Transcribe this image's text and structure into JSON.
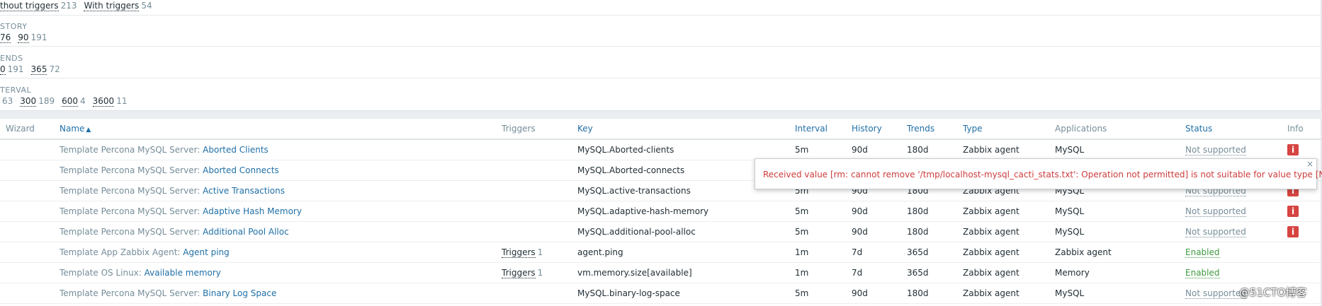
{
  "filters": {
    "triggers_row": [
      {
        "label": "thout triggers",
        "count": "213"
      },
      {
        "label": "With triggers",
        "count": "54"
      }
    ],
    "history": {
      "title": "STORY",
      "items": [
        {
          "label": "76",
          "count": ""
        },
        {
          "label": "90",
          "count": "191"
        }
      ]
    },
    "trends": {
      "title": "ENDS",
      "items": [
        {
          "label": "0",
          "count": "191"
        },
        {
          "label": "365",
          "count": "72"
        }
      ]
    },
    "interval": {
      "title": "TERVAL",
      "items": [
        {
          "label": "",
          "count": "63"
        },
        {
          "label": "300",
          "count": "189"
        },
        {
          "label": "600",
          "count": "4"
        },
        {
          "label": "3600",
          "count": "11"
        }
      ]
    }
  },
  "table": {
    "headers": {
      "wizard": "Wizard",
      "name": "Name",
      "triggers": "Triggers",
      "key": "Key",
      "interval": "Interval",
      "history": "History",
      "trends": "Trends",
      "type": "Type",
      "applications": "Applications",
      "status": "Status",
      "info": "Info"
    },
    "sort_indicator": "▲",
    "rows": [
      {
        "template": "Template Percona MySQL Server",
        "name": "Aborted Clients",
        "triggers": "",
        "trig_count": "",
        "key": "MySQL.Aborted-clients",
        "interval": "5m",
        "history": "90d",
        "trends": "180d",
        "type": "Zabbix agent",
        "app": "MySQL",
        "status": "Not supported",
        "info": "i"
      },
      {
        "template": "Template Percona MySQL Server",
        "name": "Aborted Connects",
        "triggers": "",
        "trig_count": "",
        "key": "MySQL.Aborted-connects",
        "interval": "",
        "history": "",
        "trends": "",
        "type": "",
        "app": "",
        "status": "",
        "info": ""
      },
      {
        "template": "Template Percona MySQL Server",
        "name": "Active Transactions",
        "triggers": "",
        "trig_count": "",
        "key": "MySQL.active-transactions",
        "interval": "5m",
        "history": "90d",
        "trends": "180d",
        "type": "Zabbix agent",
        "app": "MySQL",
        "status": "Not supported",
        "info": "i"
      },
      {
        "template": "Template Percona MySQL Server",
        "name": "Adaptive Hash Memory",
        "triggers": "",
        "trig_count": "",
        "key": "MySQL.adaptive-hash-memory",
        "interval": "5m",
        "history": "90d",
        "trends": "180d",
        "type": "Zabbix agent",
        "app": "MySQL",
        "status": "Not supported",
        "info": "i"
      },
      {
        "template": "Template Percona MySQL Server",
        "name": "Additional Pool Alloc",
        "triggers": "",
        "trig_count": "",
        "key": "MySQL.additional-pool-alloc",
        "interval": "5m",
        "history": "90d",
        "trends": "180d",
        "type": "Zabbix agent",
        "app": "MySQL",
        "status": "Not supported",
        "info": "i"
      },
      {
        "template": "Template App Zabbix Agent",
        "name": "Agent ping",
        "triggers": "Triggers",
        "trig_count": "1",
        "key": "agent.ping",
        "interval": "1m",
        "history": "7d",
        "trends": "365d",
        "type": "Zabbix agent",
        "app": "Zabbix agent",
        "status": "Enabled",
        "info": ""
      },
      {
        "template": "Template OS Linux",
        "name": "Available memory",
        "triggers": "Triggers",
        "trig_count": "1",
        "key": "vm.memory.size[available]",
        "interval": "1m",
        "history": "7d",
        "trends": "365d",
        "type": "Zabbix agent",
        "app": "Memory",
        "status": "Enabled",
        "info": ""
      },
      {
        "template": "Template Percona MySQL Server",
        "name": "Binary Log Space",
        "triggers": "",
        "trig_count": "",
        "key": "MySQL.binary-log-space",
        "interval": "5m",
        "history": "90d",
        "trends": "180d",
        "type": "Zabbix agent",
        "app": "MySQL",
        "status": "Not supported",
        "info": ""
      }
    ]
  },
  "hint": {
    "message": "Received value [rm: cannot remove '/tmp/localhost-mysql_cacti_stats.txt': Operation not permitted] is not suitable for value type [Numeric (float)]",
    "close": "×"
  },
  "watermark": "@51CTO博客",
  "colors": {
    "link": "#1f6fa6",
    "muted": "#768d99",
    "error": "#cd3c3c",
    "enabled": "#3f9a3f"
  }
}
